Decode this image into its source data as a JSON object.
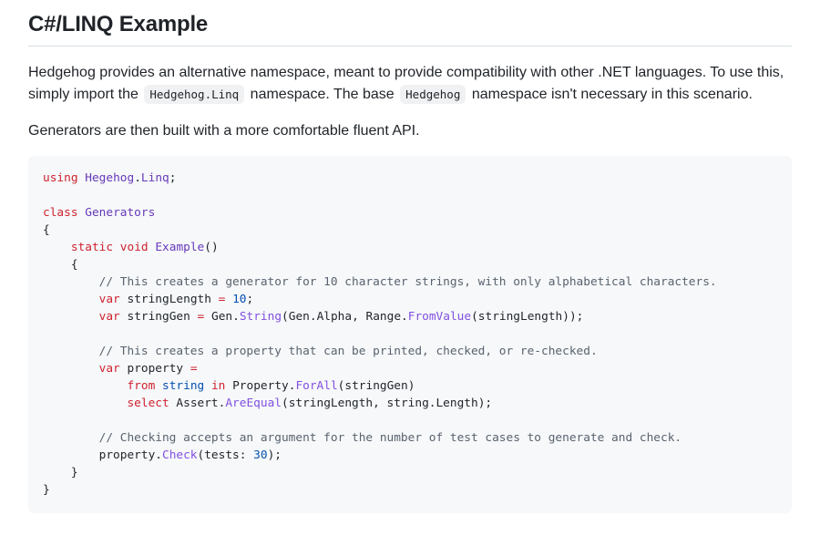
{
  "heading": "C#/LINQ Example",
  "intro": {
    "part1": "Hedgehog provides an alternative namespace, meant to provide compatibility with other .NET languages. To use this,",
    "part2a": "simply import the",
    "code1": "Hedgehog.Linq",
    "part2b": "namespace. The base",
    "code2": "Hedgehog",
    "part2c": "namespace isn't necessary in this scenario."
  },
  "generators_text": "Generators are then built with a more comfortable fluent API.",
  "code": {
    "l1_using": "using",
    "l1_ns1": "Hegehog",
    "l1_dot": ".",
    "l1_ns2": "Linq",
    "l1_semi": ";",
    "l3_class": "class",
    "l3_name": "Generators",
    "brace_open": "{",
    "brace_close": "}",
    "l5_static": "static",
    "l5_void": "void",
    "l5_method": "Example",
    "l5_parens": "()",
    "c1": "// This creates a generator for 10 character strings, with only alphabetical characters.",
    "var": "var",
    "l8_name": "stringLength",
    "eq": "=",
    "l8_num": "10",
    "l9_name": "stringGen",
    "l9_gen": "Gen.",
    "l9_string": "String",
    "l9_args1": "(Gen.Alpha, Range.",
    "l9_fromvalue": "FromValue",
    "l9_args2": "(stringLength));",
    "c2": "// This creates a property that can be printed, checked, or re-checked.",
    "l12_name": "property",
    "l13_from": "from",
    "l13_string": "string",
    "l13_in": "in",
    "l13_prop": "Property.",
    "l13_forall": "ForAll",
    "l13_arg": "(stringGen)",
    "l14_select": "select",
    "l14_assert": "Assert.",
    "l14_areequal": "AreEqual",
    "l14_args": "(stringLength, string.Length);",
    "c3": "// Checking accepts an argument for the number of test cases to generate and check.",
    "l17_prop": "property.",
    "l17_check": "Check",
    "l17_open": "(tests: ",
    "l17_num": "30",
    "l17_close": ");"
  }
}
